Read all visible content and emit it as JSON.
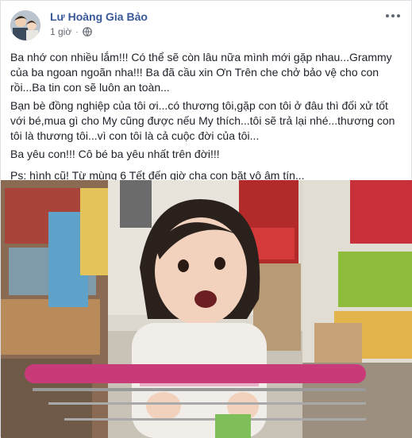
{
  "post": {
    "author": "Lư Hoàng Gia Bảo",
    "time": "1 giờ",
    "separator": "·",
    "paragraphs": [
      "Ba nhớ con nhiều lắm!!! Có thể sẽ còn lâu nữa mình mới gặp nhau...Grammy của ba ngoan ngoãn nha!!! Ba đã cầu xin Ơn Trên che chở bảo vệ cho con rồi...Ba tin con sẽ luôn an toàn...",
      "Bạn bè đồng nghiệp của tôi ơi...có thương tôi,gặp con tôi ở đâu thì đối xử tốt với bé,mua gì cho My cũng được nếu My thích...tôi sẽ trả lại nhé...thương con tôi là thương tôi...vì con tôi là cả cuộc đời của tôi...",
      "Ba yêu con!!! Cô bé ba yêu nhất trên đời!!!",
      "Ps: hình cũ! Từ mùng 6 Tết đến giờ cha con bặt vô âm tín..."
    ]
  },
  "icons": {
    "globe": "globe-icon",
    "more": "more-options-icon",
    "avatar": "profile-avatar"
  },
  "colors": {
    "author_link": "#385898",
    "meta_text": "#606770",
    "body_text": "#1d2129"
  }
}
